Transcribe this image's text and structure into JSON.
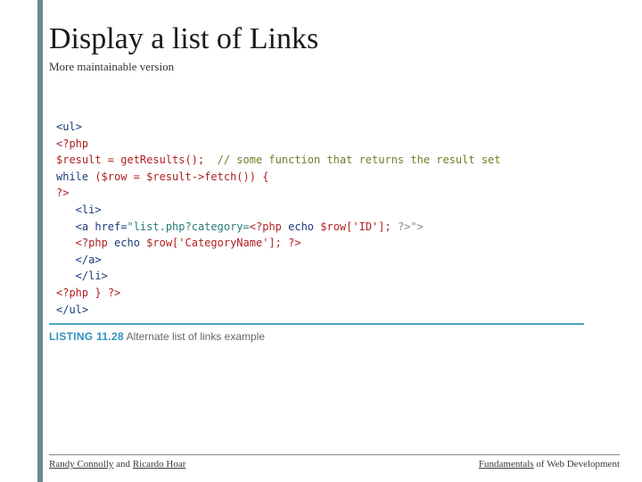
{
  "title": "Display a list of Links",
  "subtitle": "More maintainable version",
  "code": {
    "l1": "<ul>",
    "l2": "<?php",
    "l3a": "$result = getResults();  ",
    "l3b": "// some function that returns the result set",
    "l4a": "while",
    "l4b": " ($row = $result->fetch()) {",
    "l5": "?>",
    "l6": "   <li>",
    "l7a": "   <a href=",
    "l7b": "\"list.php?category=",
    "l7c": "<?php ",
    "l7d": "echo",
    "l7e": " $row['ID']; ",
    "l7f": "?>",
    "l7g": "\">",
    "l8a": "   <?php ",
    "l8b": "echo",
    "l8c": " $row['CategoryName']; ",
    "l8d": "?>",
    "l9": "   </a>",
    "l10": "   </li>",
    "l11a": "<?php ",
    "l11b": "} ",
    "l11c": "?>",
    "l12": "</ul>"
  },
  "listing": {
    "label": "LISTING 11.28",
    "text": " Alternate list of links example"
  },
  "footer": {
    "left_a": "Randy Connolly",
    "left_mid": " and ",
    "left_b": "Ricardo Hoar",
    "right_a": "Fundamentals",
    "right_b": " of Web Development"
  }
}
